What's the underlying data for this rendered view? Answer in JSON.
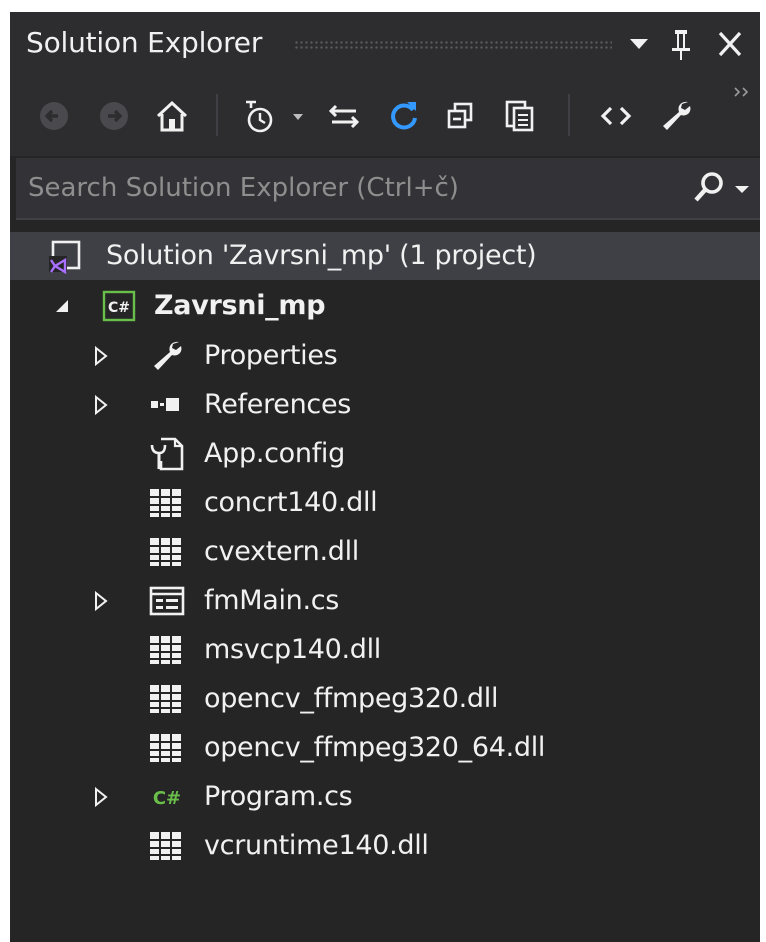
{
  "window": {
    "title": "Solution Explorer",
    "dropdown_glyph": "▼",
    "pin_glyph": "📌",
    "close_glyph": "✕"
  },
  "toolbar": {
    "icons": [
      "back-icon",
      "forward-icon",
      "home-icon",
      "pending-changes-filter-icon",
      "sync-with-active-document-icon",
      "refresh-icon",
      "collapse-all-icon",
      "show-all-files-icon",
      "view-code-icon",
      "properties-wrench-icon"
    ]
  },
  "search": {
    "placeholder": "Search Solution Explorer (Ctrl+č)",
    "value": ""
  },
  "tree": {
    "solution": "Solution 'Zavrsni_mp' (1 project)",
    "project": "Zavrsni_mp",
    "items": [
      {
        "label": "Properties",
        "icon": "wrench-icon",
        "expandable": true
      },
      {
        "label": "References",
        "icon": "references-icon",
        "expandable": true
      },
      {
        "label": "App.config",
        "icon": "config-file-icon",
        "expandable": false
      },
      {
        "label": "concrt140.dll",
        "icon": "dll-icon",
        "expandable": false
      },
      {
        "label": "cvextern.dll",
        "icon": "dll-icon",
        "expandable": false
      },
      {
        "label": "fmMain.cs",
        "icon": "form-icon",
        "expandable": true
      },
      {
        "label": "msvcp140.dll",
        "icon": "dll-icon",
        "expandable": false
      },
      {
        "label": "opencv_ffmpeg320.dll",
        "icon": "dll-icon",
        "expandable": false
      },
      {
        "label": "opencv_ffmpeg320_64.dll",
        "icon": "dll-icon",
        "expandable": false
      },
      {
        "label": "Program.cs",
        "icon": "csharp-file-icon",
        "expandable": true
      },
      {
        "label": "vcruntime140.dll",
        "icon": "dll-icon",
        "expandable": false
      }
    ]
  },
  "colors": {
    "background": "#252526",
    "titlebar": "#2d2d30",
    "text": "#f1f1f1",
    "selection": "#3f3f46",
    "refresh_accent": "#3399ff",
    "csharp_green": "#6abf4b",
    "solution_purple": "#a970ff"
  }
}
